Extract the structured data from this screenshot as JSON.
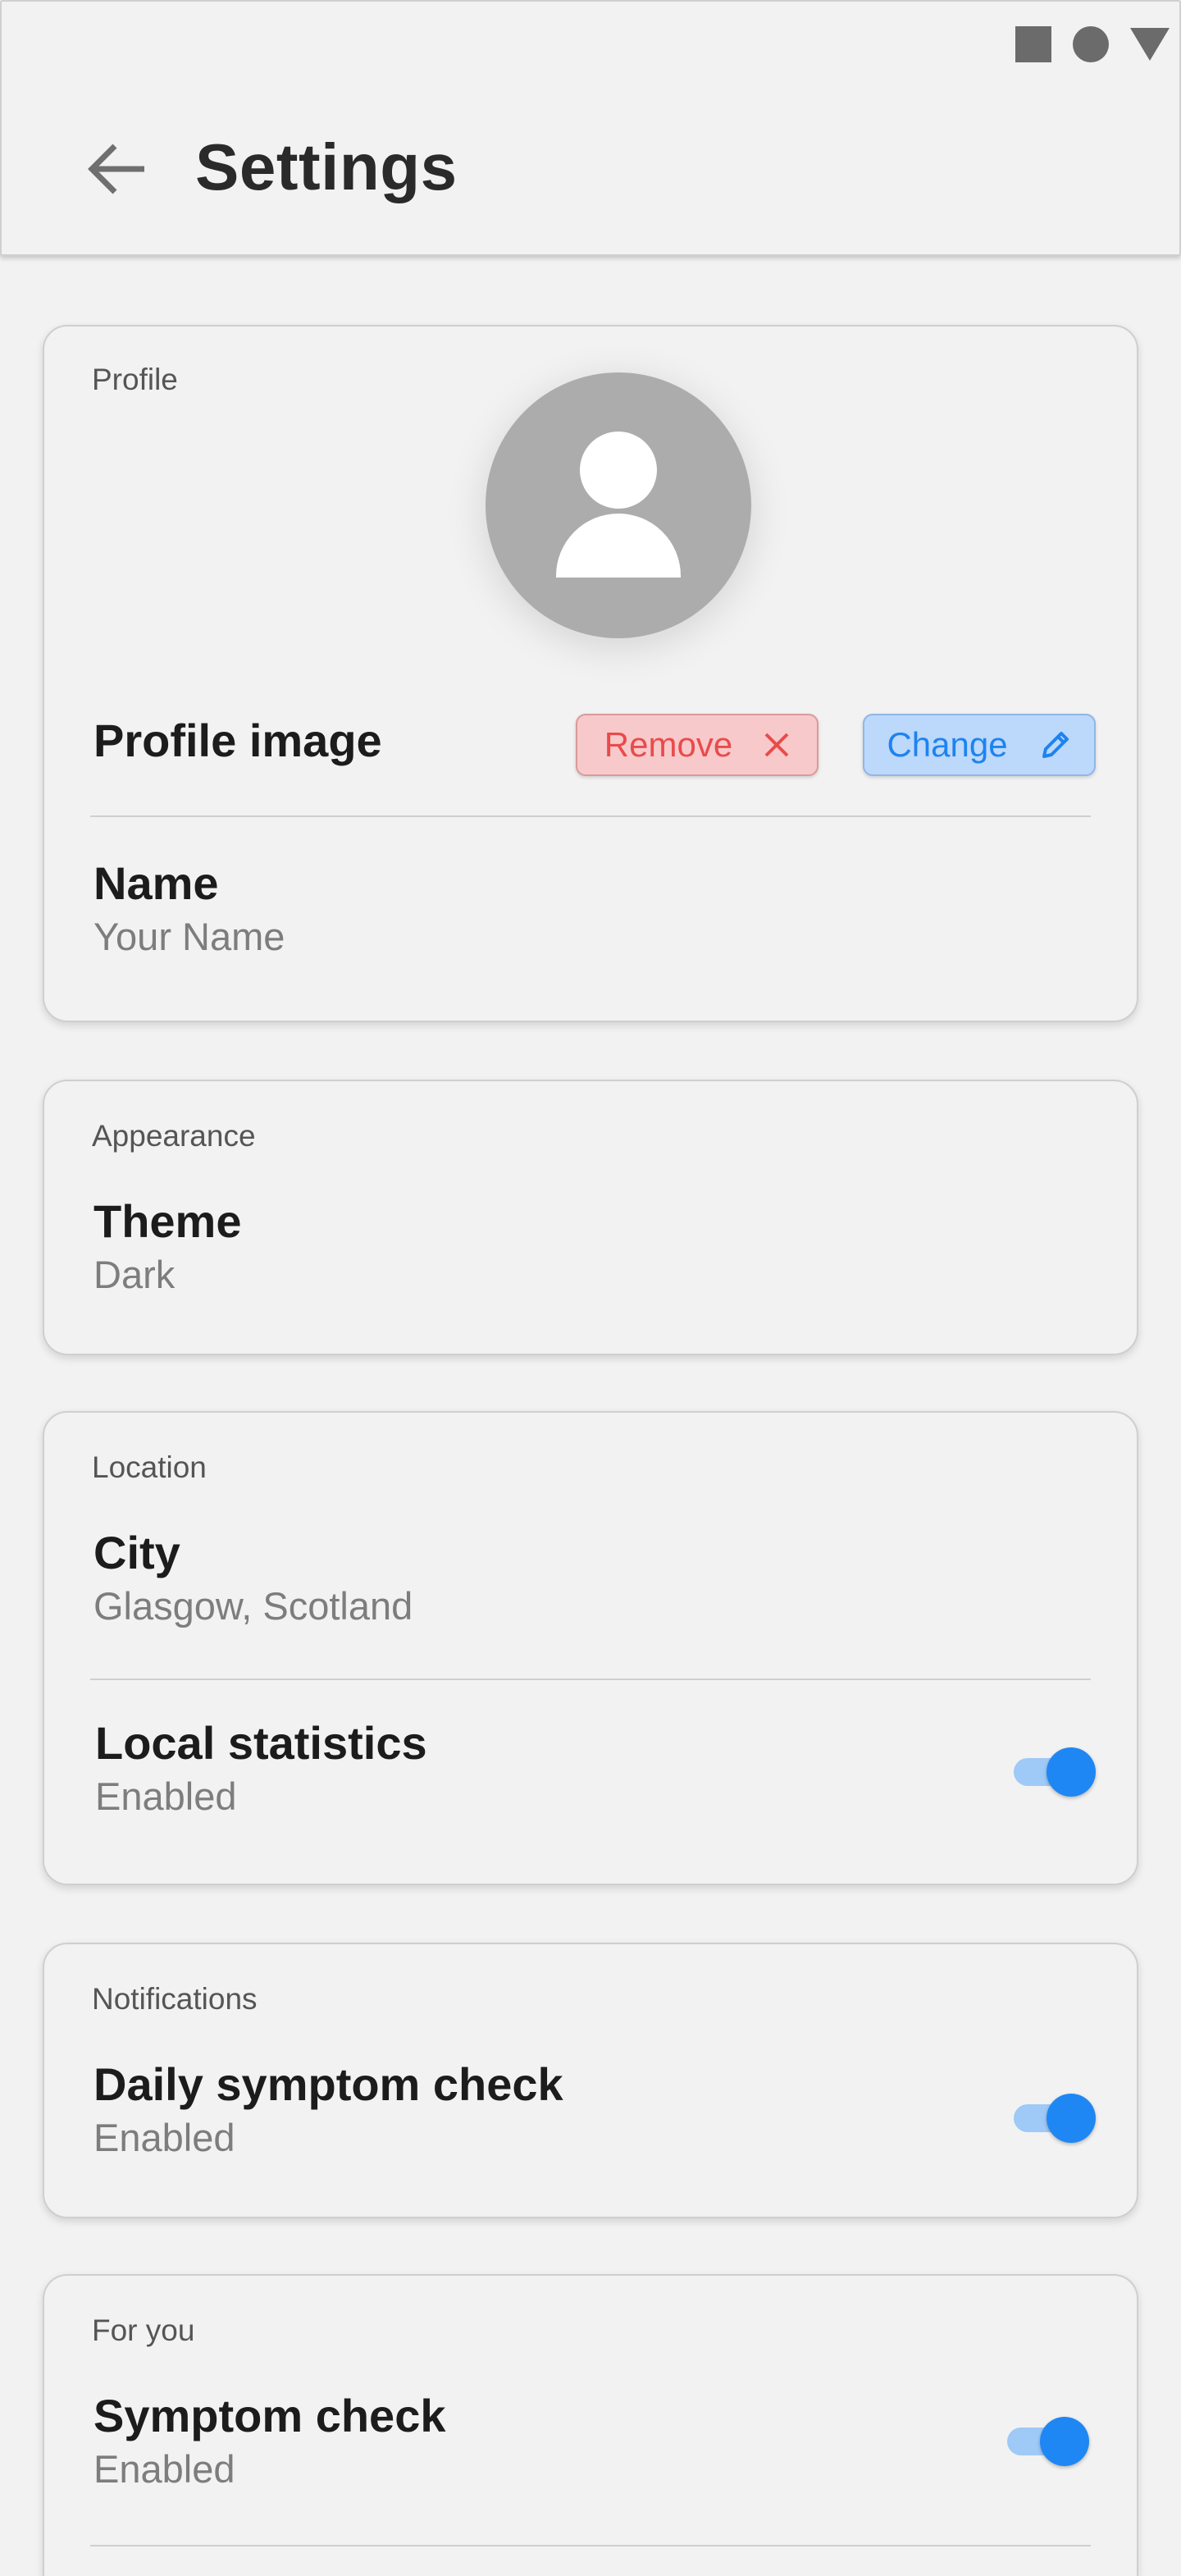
{
  "app_bar": {
    "title": "Settings",
    "back_icon": "arrow-left-icon"
  },
  "system_bar": {
    "icons": [
      "square-icon",
      "circle-icon",
      "triangle-down-icon"
    ]
  },
  "profile": {
    "section_label": "Profile",
    "avatar_icon": "person-icon",
    "image_label": "Profile image",
    "remove_label": "Remove",
    "remove_icon": "close-icon",
    "change_label": "Change",
    "change_icon": "pencil-icon",
    "name_title": "Name",
    "name_value": "Your Name"
  },
  "appearance": {
    "section_label": "Appearance",
    "theme_title": "Theme",
    "theme_value": "Dark"
  },
  "location": {
    "section_label": "Location",
    "city_title": "City",
    "city_value": "Glasgow, Scotland",
    "local_stats_title": "Local statistics",
    "local_stats_value": "Enabled",
    "local_stats_on": true
  },
  "notifications": {
    "section_label": "Notifications",
    "daily_check_title": "Daily symptom check",
    "daily_check_value": "Enabled",
    "daily_check_on": true
  },
  "for_you": {
    "section_label": "For you",
    "symptom_check_title": "Symptom check",
    "symptom_check_value": "Enabled",
    "symptom_check_on": true
  },
  "colors": {
    "background": "#f2f2f2",
    "accent_blue": "#1f87f3",
    "remove_red": "#e94b4b",
    "avatar_grey": "#acacac"
  }
}
